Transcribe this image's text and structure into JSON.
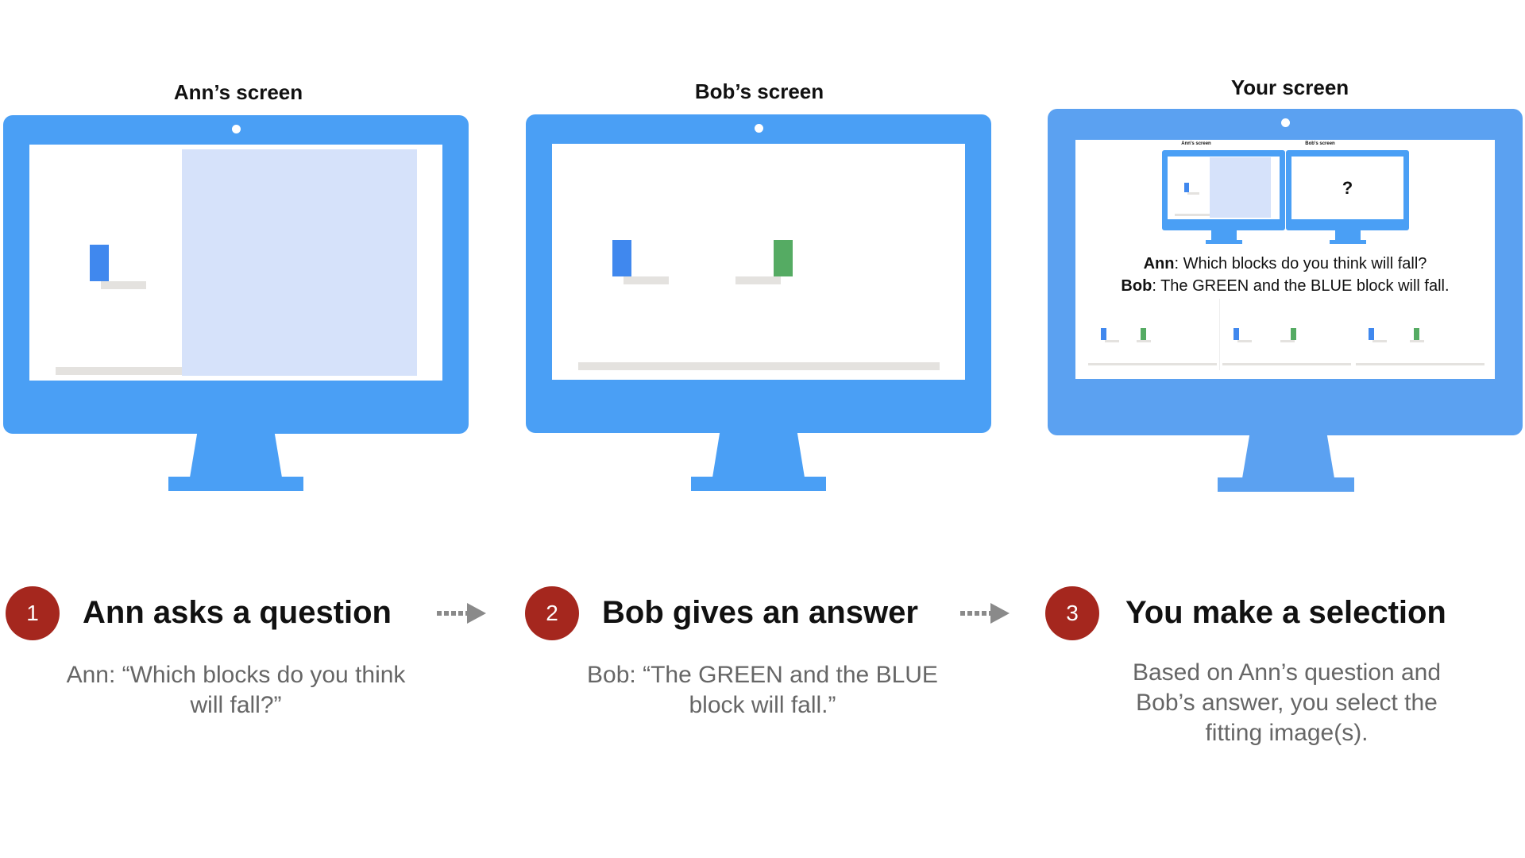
{
  "screens": [
    {
      "title": "Ann’s screen"
    },
    {
      "title": "Bob’s screen"
    },
    {
      "title": "Your screen"
    }
  ],
  "your_screen": {
    "mini_titles": [
      "Ann's screen",
      "Bob's screen"
    ],
    "hidden_marker": "?",
    "dialogue": [
      {
        "speaker": "Ann",
        "text": ": Which blocks do you think will fall?"
      },
      {
        "speaker": "Bob",
        "text": ": The GREEN and the BLUE block will fall."
      }
    ]
  },
  "steps": [
    {
      "number": "1",
      "heading": "Ann asks a question",
      "lines": [
        "Ann: “Which blocks do you think",
        "will fall?”"
      ]
    },
    {
      "number": "2",
      "heading": "Bob gives an answer",
      "lines": [
        "Bob: “The GREEN and the BLUE",
        "block will fall.”"
      ]
    },
    {
      "number": "3",
      "heading": "You make a selection",
      "lines": [
        "Based on Ann’s question and",
        "Bob’s answer, you select the",
        "fitting image(s)."
      ]
    }
  ],
  "colors": {
    "monitor": "#4a9ff5",
    "step_circle": "#a5271e",
    "blue_block": "#4088ee",
    "green_block": "#55ab63",
    "hidden_region": "#d6e2fa"
  }
}
